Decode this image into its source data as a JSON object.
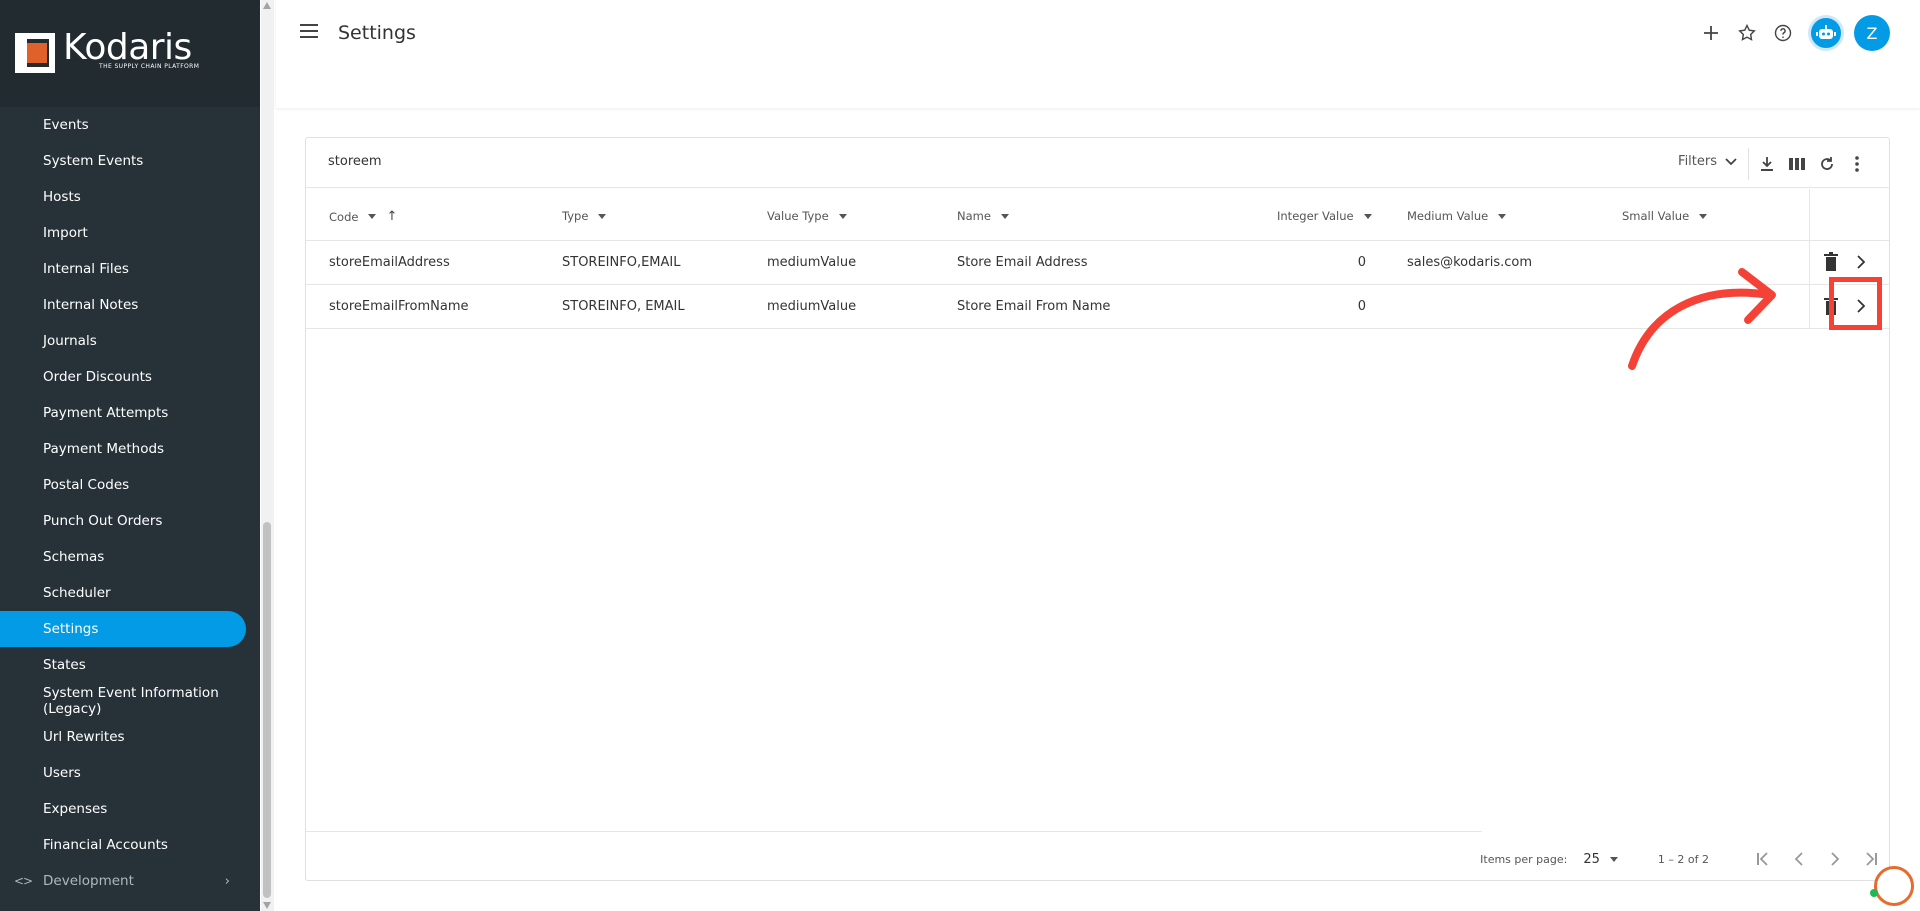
{
  "app": {
    "brand": "Kodaris",
    "tagline": "THE SUPPLY CHAIN PLATFORM"
  },
  "header": {
    "title": "Settings",
    "avatar_initial": "Z"
  },
  "sidebar": {
    "items": [
      {
        "label": "Events"
      },
      {
        "label": "System Events"
      },
      {
        "label": "Hosts"
      },
      {
        "label": "Import"
      },
      {
        "label": "Internal Files"
      },
      {
        "label": "Internal Notes"
      },
      {
        "label": "Journals"
      },
      {
        "label": "Order Discounts"
      },
      {
        "label": "Payment Attempts"
      },
      {
        "label": "Payment Methods"
      },
      {
        "label": "Postal Codes"
      },
      {
        "label": "Punch Out Orders"
      },
      {
        "label": "Schemas"
      },
      {
        "label": "Scheduler"
      },
      {
        "label": "Settings",
        "active": true
      },
      {
        "label": "States"
      },
      {
        "label": "System Event Information (Legacy)"
      },
      {
        "label": "Url Rewrites"
      },
      {
        "label": "Users"
      },
      {
        "label": "Expenses"
      },
      {
        "label": "Financial Accounts"
      }
    ],
    "development": {
      "label": "Development"
    }
  },
  "toolbar": {
    "search_value": "storeem",
    "filters_label": "Filters"
  },
  "table": {
    "columns": [
      "Code",
      "Type",
      "Value Type",
      "Name",
      "Integer Value",
      "Medium Value",
      "Small Value"
    ],
    "rows": [
      {
        "code": "storeEmailAddress",
        "type": "STOREINFO,EMAIL",
        "value_type": "mediumValue",
        "name": "Store Email Address",
        "integer_value": "0",
        "medium_value": "sales@kodaris.com",
        "small_value": ""
      },
      {
        "code": "storeEmailFromName",
        "type": "STOREINFO, EMAIL",
        "value_type": "mediumValue",
        "name": "Store Email From Name",
        "integer_value": "0",
        "medium_value": "",
        "small_value": ""
      }
    ]
  },
  "paginator": {
    "items_per_page_label": "Items per page:",
    "page_size": "25",
    "range": "1 – 2 of 2"
  },
  "colors": {
    "sidebar_bg": "#263238",
    "accent": "#039be5",
    "annotation": "#f44336"
  }
}
